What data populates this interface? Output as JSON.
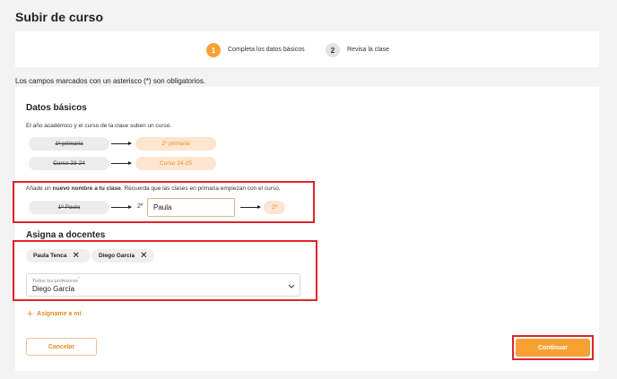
{
  "page": {
    "title": "Subir de curso"
  },
  "stepper": {
    "steps": [
      {
        "number": "1",
        "label": "Completa los datos básicos"
      },
      {
        "number": "2",
        "label": "Revisa la clase"
      }
    ]
  },
  "required_note": "Los campos marcados con un asterisco (*) son obligatorios.",
  "basic": {
    "heading": "Datos básicos",
    "description": "El año académico y el curso de la clase suben un curso.",
    "year_from": "1º primaria",
    "year_to": "2º primaria",
    "course_from": "Curso 23-24",
    "course_to": "Curso 24-25"
  },
  "name_section": {
    "hint_prefix": "Añade un ",
    "hint_bold": "nuevo nombre a tu clase",
    "hint_suffix": ". Recuerda que las clases en primaria empiezan con el curso.",
    "old_name": "1º Paula",
    "prefix": "2º",
    "input_value": "Paula",
    "result": "2º"
  },
  "teachers": {
    "heading": "Asigna a docentes",
    "chips": [
      "Paula Tenca",
      "Diego García"
    ],
    "select_label": "Todos los profesores",
    "select_required_mark": "*",
    "select_value": "Diego García",
    "assign_me": "Asígname a mí"
  },
  "footer": {
    "cancel": "Cancelar",
    "continue": "Continuar"
  },
  "colors": {
    "accent": "#f7a133",
    "accent_light": "#fde5cf",
    "highlight": "#e0242a"
  }
}
